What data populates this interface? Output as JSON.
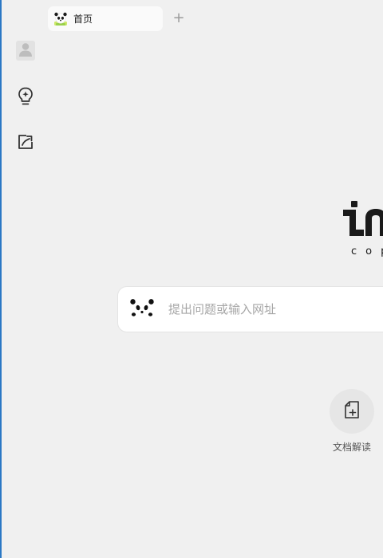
{
  "tabs": [
    {
      "title": "首页",
      "icon": "panda-icon",
      "active": true
    }
  ],
  "tab_bar": {
    "new_tab_label": "+"
  },
  "sidebar": {
    "items": [
      {
        "name": "avatar",
        "icon": "user-avatar-icon"
      },
      {
        "name": "ideas",
        "icon": "lightbulb-icon"
      },
      {
        "name": "write",
        "icon": "edit-icon"
      }
    ]
  },
  "brand": {
    "logo_sub_text": "cop"
  },
  "search": {
    "placeholder": "提出问题或输入网址",
    "value": ""
  },
  "features": [
    {
      "label": "文档解读",
      "icon": "document-plus-icon"
    }
  ],
  "colors": {
    "background": "#f0f0f0",
    "window_border": "#2b78c5",
    "tab_bg": "#fafafa",
    "search_bg": "#ffffff",
    "placeholder": "#a6a6a6",
    "icon": "#333333"
  }
}
